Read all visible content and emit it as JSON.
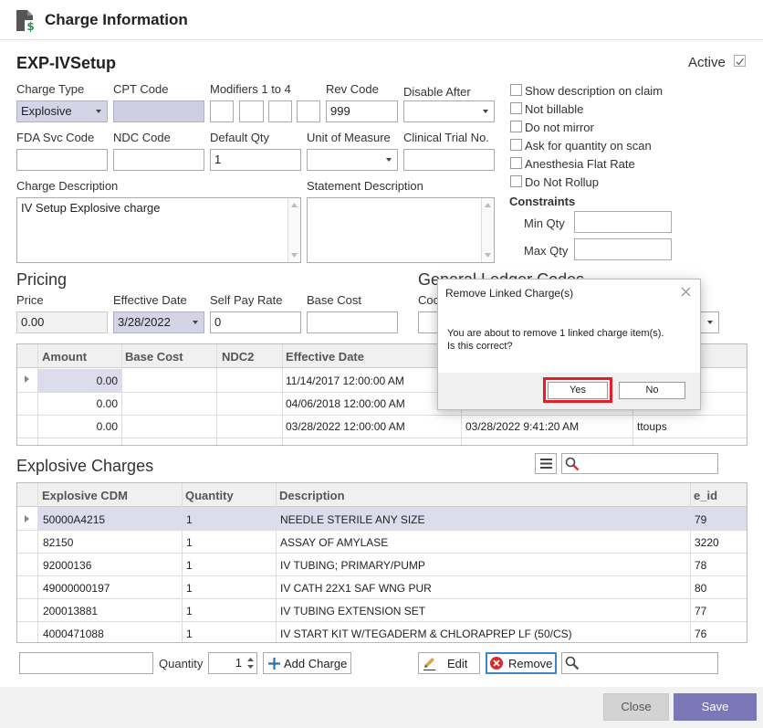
{
  "window": {
    "title": "Charge Information"
  },
  "form": {
    "name": "EXP-IVSetup",
    "active_label": "Active",
    "charge_type_label": "Charge Type",
    "charge_type_value": "Explosive",
    "cpt_label": "CPT Code",
    "cpt_value": "",
    "modifiers_label": "Modifiers 1 to 4",
    "rev_label": "Rev Code",
    "rev_value": "999",
    "disable_after_label": "Disable After",
    "fda_label": "FDA Svc Code",
    "ndc_label": "NDC Code",
    "default_qty_label": "Default Qty",
    "default_qty_value": "1",
    "uom_label": "Unit of Measure",
    "clinical_label": "Clinical Trial No.",
    "charge_desc_label": "Charge Description",
    "charge_desc_value": "IV Setup Explosive charge",
    "statement_desc_label": "Statement Description",
    "checkboxes": [
      "Show description on claim",
      "Not billable",
      "Do not mirror",
      "Ask for quantity on scan",
      "Anesthesia Flat Rate",
      "Do Not Rollup"
    ],
    "constraints_label": "Constraints",
    "min_qty_label": "Min Qty",
    "max_qty_label": "Max Qty"
  },
  "pricing": {
    "title": "Pricing",
    "price_label": "Price",
    "price_value": "0.00",
    "eff_date_label": "Effective Date",
    "eff_date_value": "3/28/2022",
    "self_pay_label": "Self Pay Rate",
    "self_pay_value": "0",
    "base_cost_label": "Base Cost",
    "gl_title": "General Ledger Codes",
    "gl_code_label": "Coc",
    "columns": [
      "Amount",
      "Base Cost",
      "NDC2",
      "Effective Date"
    ],
    "rows": [
      {
        "amount": "0.00",
        "eff": "11/14/2017 12:00:00 AM",
        "mod": "",
        "user": ""
      },
      {
        "amount": "0.00",
        "eff": "04/06/2018 12:00:00 AM",
        "mod": "",
        "user": ""
      },
      {
        "amount": "0.00",
        "eff": "03/28/2022 12:00:00 AM",
        "mod": "03/28/2022 9:41:20 AM",
        "user": "ttoups"
      }
    ]
  },
  "explosive": {
    "title": "Explosive Charges",
    "columns": [
      "Explosive CDM",
      "Quantity",
      "Description",
      "e_id"
    ],
    "rows": [
      {
        "cdm": "50000A4215",
        "qty": "1",
        "desc": "NEEDLE STERILE ANY SIZE",
        "eid": "79"
      },
      {
        "cdm": "82150",
        "qty": "1",
        "desc": "ASSAY OF AMYLASE",
        "eid": "3220"
      },
      {
        "cdm": "92000136",
        "qty": "1",
        "desc": "IV TUBING; PRIMARY/PUMP",
        "eid": "78"
      },
      {
        "cdm": "49000000197",
        "qty": "1",
        "desc": "IV CATH 22X1 SAF WNG PUR",
        "eid": "80"
      },
      {
        "cdm": "200013881",
        "qty": "1",
        "desc": "IV TUBING EXTENSION SET",
        "eid": "77"
      },
      {
        "cdm": "4000471088",
        "qty": "1",
        "desc": "IV START KIT W/TEGADERM & CHLORAPREP LF (50/CS)",
        "eid": "76"
      }
    ],
    "quantity_label": "Quantity",
    "quantity_value": "1",
    "add_charge_label": "Add Charge",
    "edit_label": "Edit",
    "remove_label": "Remove"
  },
  "footer": {
    "close_label": "Close",
    "save_label": "Save"
  },
  "dialog": {
    "title": "Remove Linked Charge(s)",
    "message_line1": "You are about to remove 1 linked charge item(s).",
    "message_line2": "Is this correct?",
    "yes_label": "Yes",
    "no_label": "No"
  },
  "colors": {
    "accent_purple": "#7b78b8",
    "selected_row": "#dcdcec",
    "highlight_red": "#e0202a"
  }
}
